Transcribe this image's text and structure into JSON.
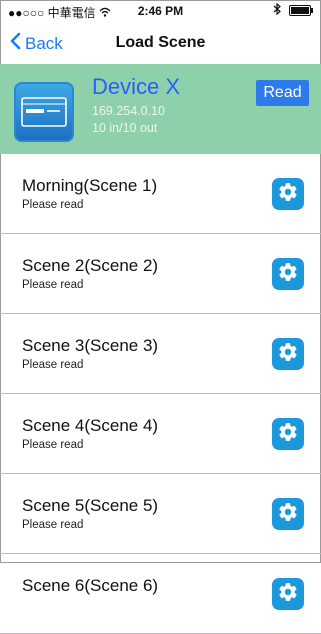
{
  "status_bar": {
    "signal": "●●○○○",
    "carrier": "中華電信",
    "time": "2:46 PM"
  },
  "nav": {
    "back_label": "Back",
    "title": "Load Scene"
  },
  "device": {
    "name": "Device X",
    "ip": "169.254.0.10",
    "io": "10 in/10 out",
    "read_label": "Read"
  },
  "scenes": [
    {
      "title": "Morning(Scene 1)",
      "subtitle": "Please read"
    },
    {
      "title": "Scene 2(Scene 2)",
      "subtitle": "Please read"
    },
    {
      "title": "Scene 3(Scene 3)",
      "subtitle": "Please read"
    },
    {
      "title": "Scene 4(Scene 4)",
      "subtitle": "Please read"
    },
    {
      "title": "Scene 5(Scene 5)",
      "subtitle": "Please read"
    },
    {
      "title": "Scene 6(Scene 6)",
      "subtitle": ""
    }
  ],
  "colors": {
    "accent": "#1a7bff",
    "device_panel_bg": "#8ed0a9",
    "read_button_bg": "#2d7bea",
    "gear_button_bg": "#1d98dc",
    "divider": "#d9b88b"
  },
  "icons": {
    "back": "chevron-left-icon",
    "wifi": "wifi-icon",
    "bluetooth": "bluetooth-icon",
    "battery": "battery-icon",
    "device": "device-rack-icon",
    "scene_settings": "gear-icon"
  }
}
